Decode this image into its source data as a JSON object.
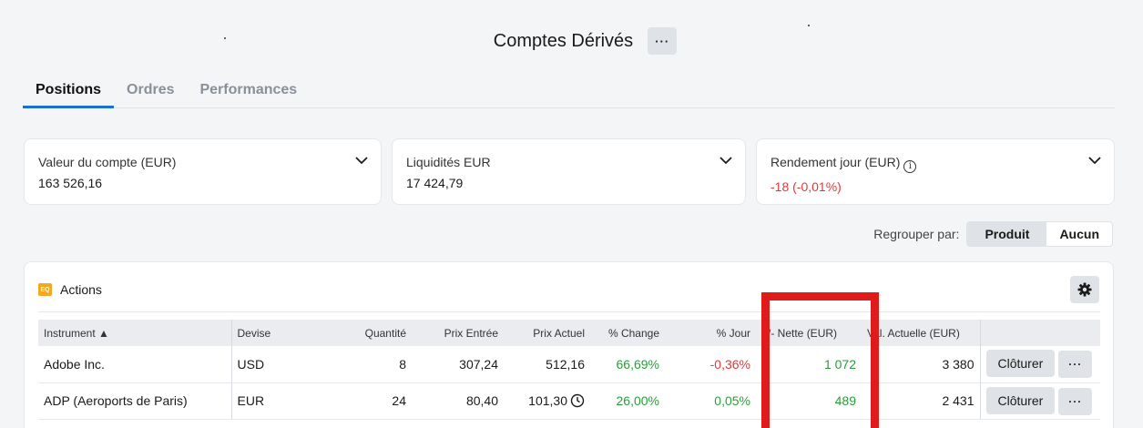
{
  "header": {
    "title": "Comptes Dérivés",
    "more_label": "···"
  },
  "tabs": [
    {
      "label": "Positions",
      "active": true
    },
    {
      "label": "Ordres",
      "active": false
    },
    {
      "label": "Performances",
      "active": false
    }
  ],
  "cards": [
    {
      "label": "Valeur du compte (EUR)",
      "value": "163 526,16"
    },
    {
      "label": "Liquidités EUR",
      "value": "17 424,79"
    },
    {
      "label": "Rendement jour (EUR)",
      "value": "-18 (-0,01%)"
    }
  ],
  "grouping": {
    "label": "Regrouper par:",
    "options": [
      "Produit",
      "Aucun"
    ],
    "selected": "Produit"
  },
  "section": {
    "badge": "EQ",
    "title": "Actions"
  },
  "table": {
    "headers": [
      "Instrument ▲",
      "Devise",
      "Quantité",
      "Prix Entrée",
      "Prix Actuel",
      "% Change",
      "% Jour",
      "+/- Nette (EUR)",
      "Val. Actuelle (EUR)",
      ""
    ],
    "rows": [
      {
        "instrument": "Adobe Inc.",
        "devise": "USD",
        "quantite": "8",
        "prix_entree": "307,24",
        "prix_actuel": "512,16",
        "change": "66,69%",
        "jour": "-0,36%",
        "nette": "1 072",
        "valeur": "3 380",
        "close_label": "Clôturer",
        "more_label": "···"
      },
      {
        "instrument": "ADP (Aeroports de Paris)",
        "devise": "EUR",
        "quantite": "24",
        "prix_entree": "80,40",
        "prix_actuel": "101,30",
        "change": "26,00%",
        "jour": "0,05%",
        "nette": "489",
        "valeur": "2 431",
        "close_label": "Clôturer",
        "more_label": "···"
      }
    ]
  },
  "colors": {
    "accent": "#1a6fd6",
    "positive": "#2a9d3a",
    "negative": "#e03a3a",
    "highlight": "#e01b1b"
  }
}
